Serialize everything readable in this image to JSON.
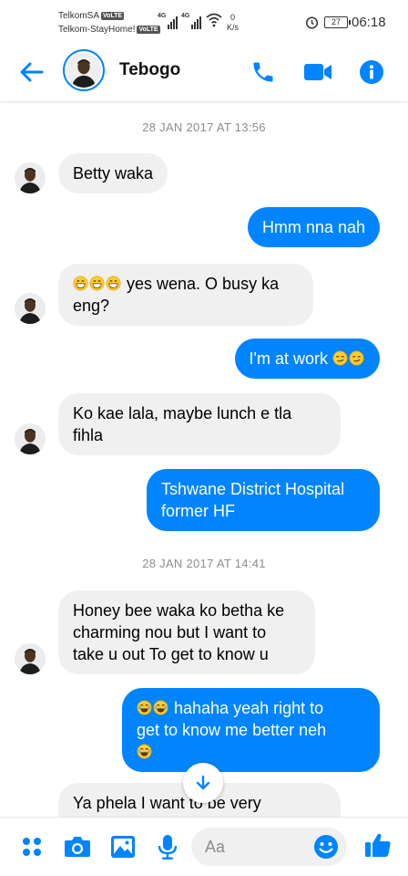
{
  "status_bar": {
    "carrier1": "TelkomSA",
    "carrier2": "Telkom-StayHome!",
    "volte": "VoLTE",
    "net1": "4G",
    "net2": "4G",
    "speed_value": "0",
    "speed_unit": "K/s",
    "battery": "27",
    "time": "06:18"
  },
  "header": {
    "contact_name": "Tebogo",
    "icons": [
      "back-arrow-icon",
      "phone-icon",
      "video-camera-icon",
      "info-icon"
    ],
    "accent_color": "#0084ff"
  },
  "conversation": {
    "timestamp1": "28 JAN 2017 AT 13:56",
    "timestamp2": "28 JAN 2017 AT 14:41",
    "messages": [
      {
        "from": "them",
        "lines": [
          "Betty waka"
        ]
      },
      {
        "from": "me",
        "lines": [
          "Hmm nna nah"
        ]
      },
      {
        "from": "them",
        "lines": [
          " yes wena. O busy ka",
          "eng?"
        ],
        "emoji": [
          "grin",
          "grin",
          "grin"
        ]
      },
      {
        "from": "me",
        "lines": [
          "I'm at work "
        ],
        "emoji": [
          "smirk",
          "smirk"
        ]
      },
      {
        "from": "them",
        "lines": [
          "Ko kae lala, maybe lunch e tla",
          "fihla"
        ]
      },
      {
        "from": "me",
        "lines": [
          "Tshwane District Hospital",
          "former HF"
        ]
      },
      {
        "from": "them",
        "lines": [
          "Honey bee waka ko betha ke",
          "charming nou but I want to",
          "take u out To get to know u"
        ]
      },
      {
        "from": "me",
        "lines": [
          " hahaha yeah right to",
          "get to know me better neh"
        ],
        "emoji": [
          "joy",
          "joy",
          "joy"
        ]
      },
      {
        "from": "them",
        "lines": [
          "Ya phela I want to be very"
        ]
      }
    ],
    "bubble_colors": {
      "incoming": "#f1f0f0",
      "outgoing": "#0084ff"
    }
  },
  "composer": {
    "placeholder": "Aa",
    "icons": [
      "more-dots-icon",
      "camera-icon",
      "gallery-icon",
      "microphone-icon",
      "emoji-icon",
      "thumbs-up-icon"
    ]
  }
}
